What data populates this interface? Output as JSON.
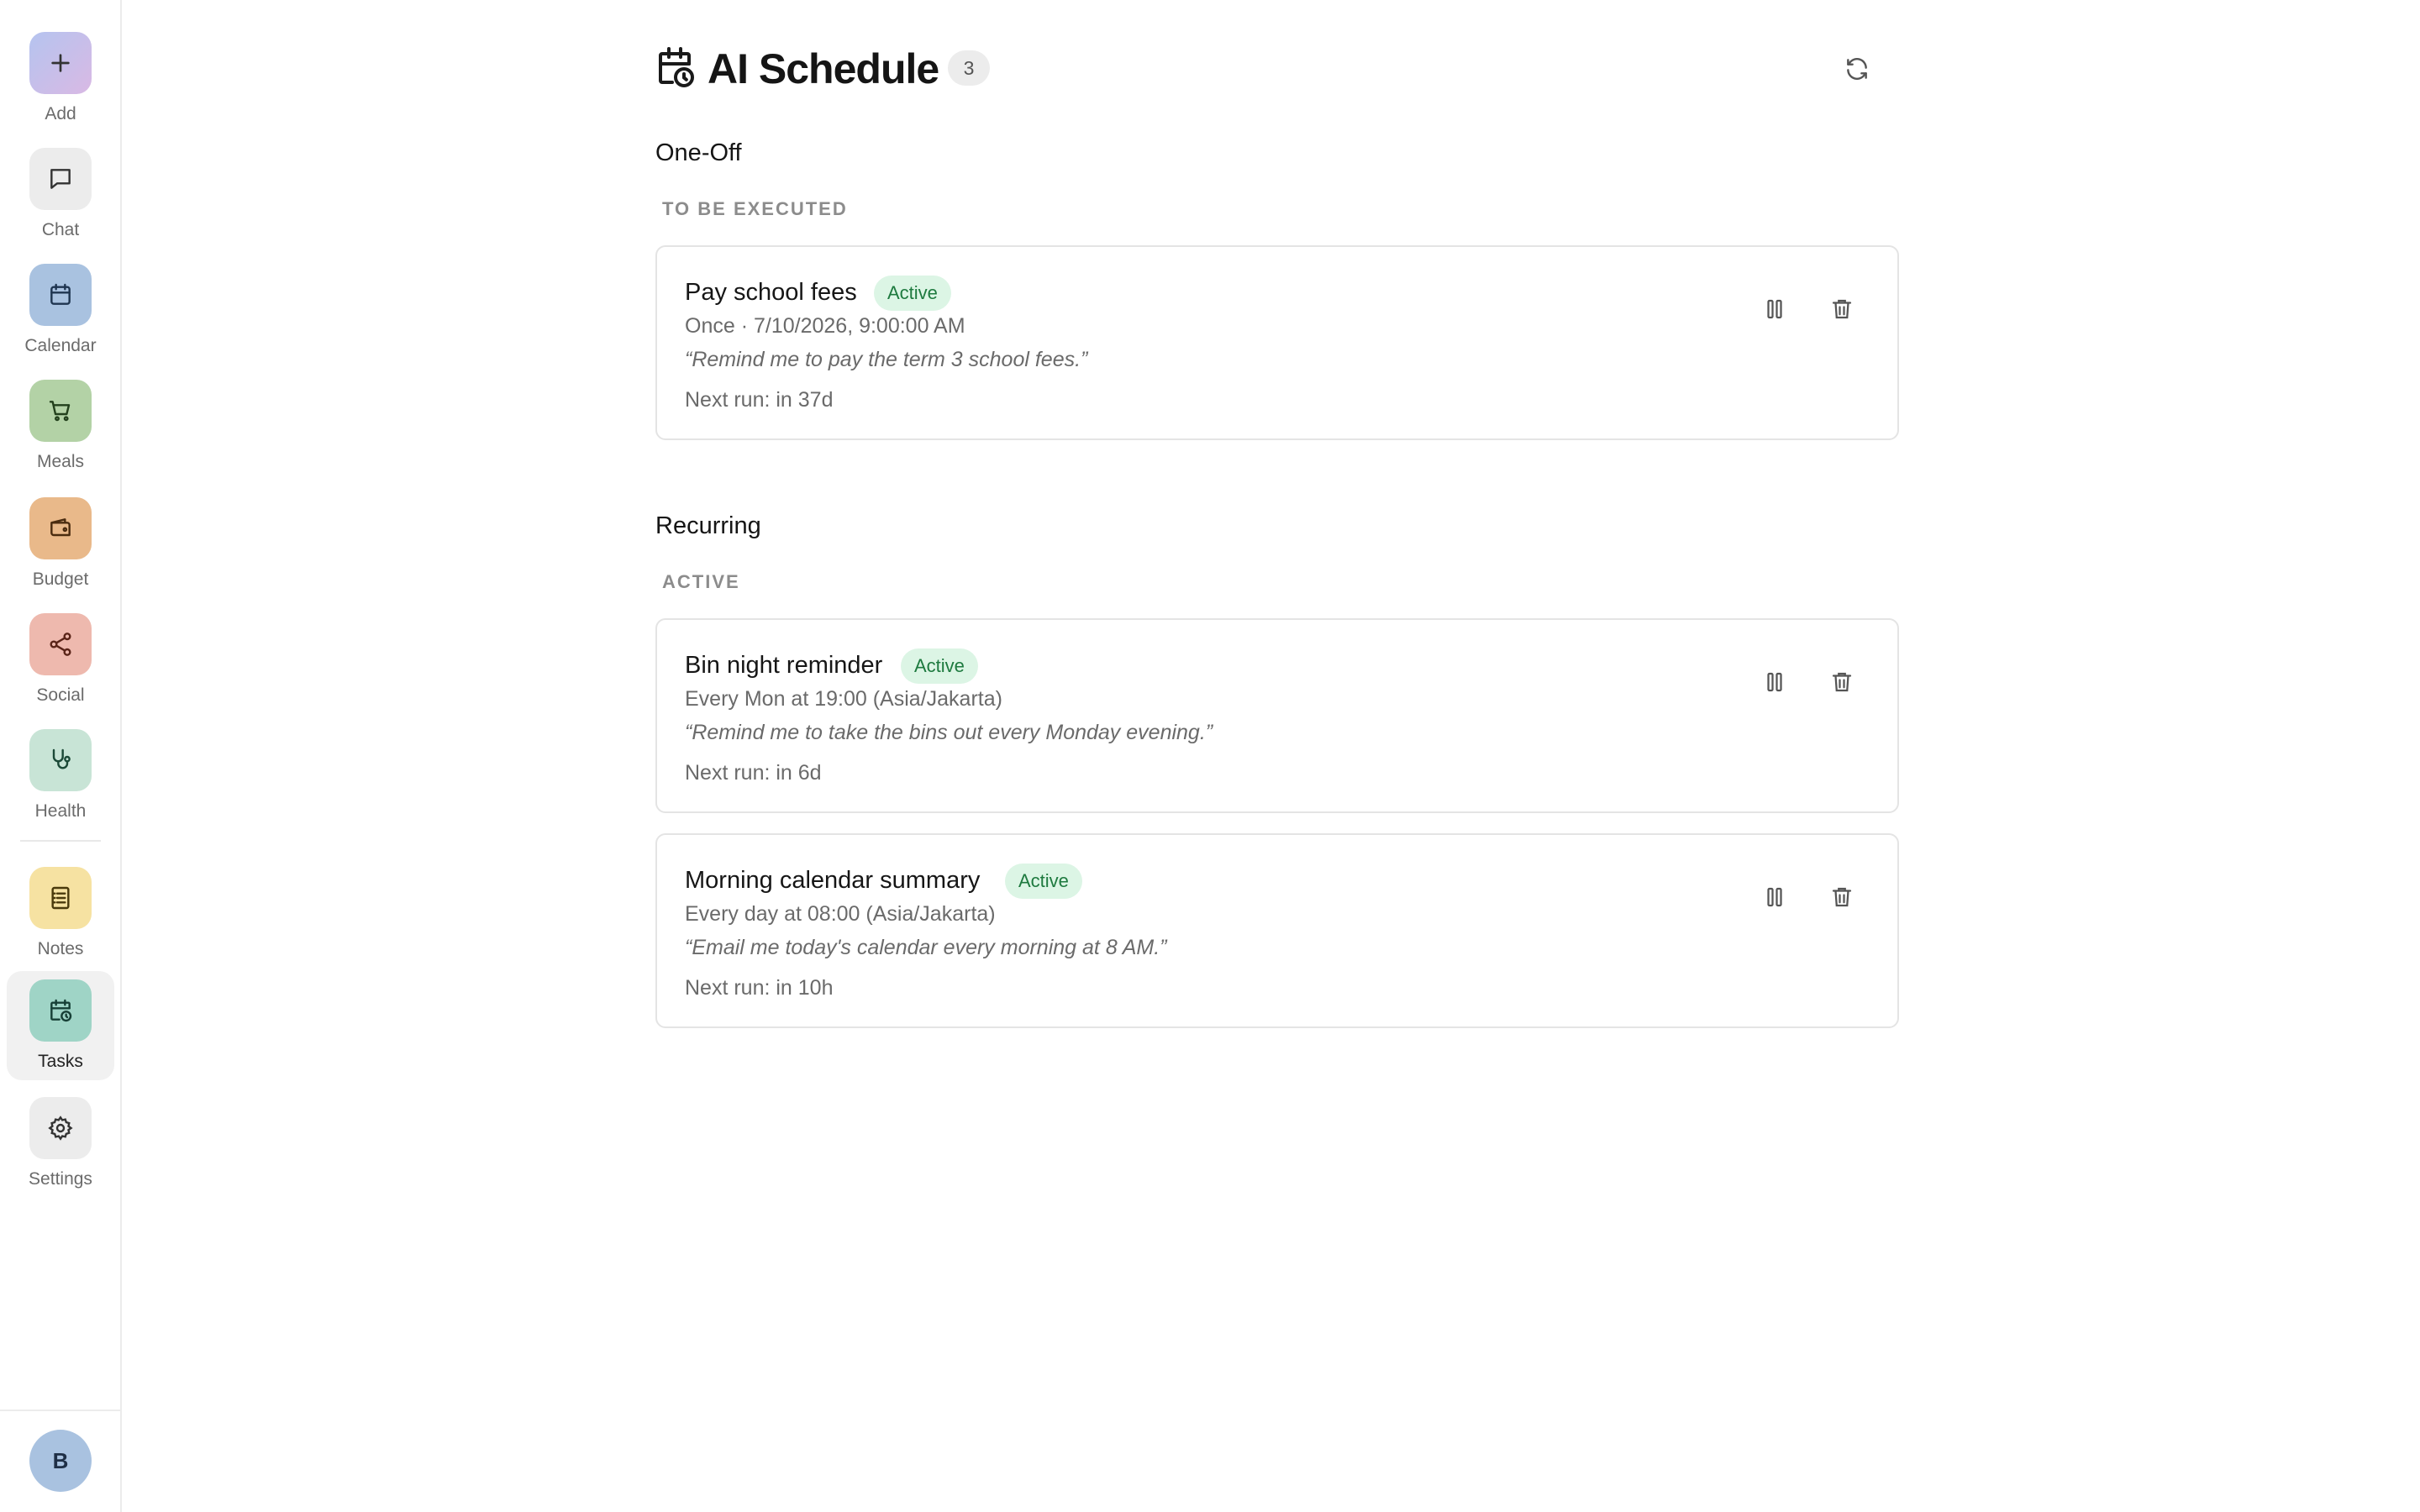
{
  "sidebar": {
    "items": [
      {
        "label": "Add",
        "icon": "plus-icon",
        "tile_color": "#c6bcea"
      },
      {
        "label": "Chat",
        "icon": "chat-bubble-icon",
        "tile_color": "#ececec"
      },
      {
        "label": "Calendar",
        "icon": "calendar-icon",
        "tile_color": "#a9c2e0"
      },
      {
        "label": "Meals",
        "icon": "shopping-cart-icon",
        "tile_color": "#b3d2a6"
      },
      {
        "label": "Budget",
        "icon": "wallet-icon",
        "tile_color": "#e9b98a"
      },
      {
        "label": "Social",
        "icon": "share-icon",
        "tile_color": "#eeb9ae"
      },
      {
        "label": "Health",
        "icon": "stethoscope-icon",
        "tile_color": "#c8e4d6"
      },
      {
        "label": "Notes",
        "icon": "notebook-icon",
        "tile_color": "#f6e2a2"
      },
      {
        "label": "Tasks",
        "icon": "calendar-clock-icon",
        "tile_color": "#9fd4c6",
        "active": true
      },
      {
        "label": "Settings",
        "icon": "gear-icon",
        "tile_color": "#ececec"
      }
    ],
    "user_initial": "B"
  },
  "header": {
    "title": "AI Schedule",
    "count": "3",
    "icon": "calendar-clock-icon",
    "refresh_icon": "refresh-icon"
  },
  "sections": {
    "one_off": {
      "title": "One-Off",
      "group_label": "TO BE EXECUTED",
      "tasks": [
        {
          "title": "Pay school fees",
          "status": "Active",
          "schedule": "Once · 7/10/2026, 9:00:00 AM",
          "prompt": "“Remind me to pay the term 3 school fees.”",
          "next_run": "Next run: in 37d"
        }
      ]
    },
    "recurring": {
      "title": "Recurring",
      "group_label": "ACTIVE",
      "tasks": [
        {
          "title": "Bin night reminder",
          "status": "Active",
          "schedule": "Every Mon at 19:00 (Asia/Jakarta)",
          "prompt": "“Remind me to take the bins out every Monday evening.”",
          "next_run": "Next run: in 6d"
        },
        {
          "title": "Morning calendar summary",
          "status": "Active",
          "schedule": "Every day at 08:00 (Asia/Jakarta)",
          "prompt": "“Email me today's calendar every morning at 8 AM.”",
          "next_run": "Next run: in 10h"
        }
      ]
    }
  },
  "colors": {
    "badge_bg": "#dcf5e5",
    "badge_text": "#1e7a3f",
    "card_border": "#e4e4e4"
  }
}
